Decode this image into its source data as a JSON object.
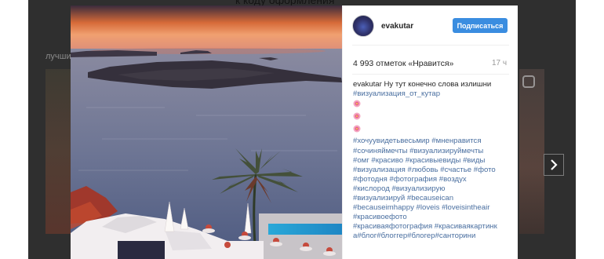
{
  "background": {
    "title_fragment": "к коду оформления",
    "section_label": "лучшие"
  },
  "post": {
    "username": "evakutar",
    "follow_label": "Подписаться",
    "likes": "4 993 отметок «Нравится»",
    "time": "17 ч",
    "caption_user": "evakutar",
    "caption_text": "Ну тут конечно слова излишни",
    "caption_tag": "#визуализация_от_кутар",
    "emoji_name": "hibiscus-flower",
    "hashtag_lines": [
      "#хочуувидетьвесьмир #мненравится",
      "#сочиняймечты #визуализируймечты",
      "#омг #красиво #красивыевиды #виды",
      "#визуализация #любовь #счастье #фото",
      "#фотодня #фотография #воздух",
      "#кислород #визуализирую",
      "#визуализируй #becauseican",
      "#becauseimhappy #loveis #loveisintheair",
      "#красивоефото",
      "#красиваяфотография #красиваякартинк",
      "а#блог#блоггер#блогер#санторини"
    ]
  },
  "colors": {
    "follow_button": "#3a8de0",
    "hashtag": "#4a6fa0",
    "backdrop": "#2f2f2f"
  }
}
